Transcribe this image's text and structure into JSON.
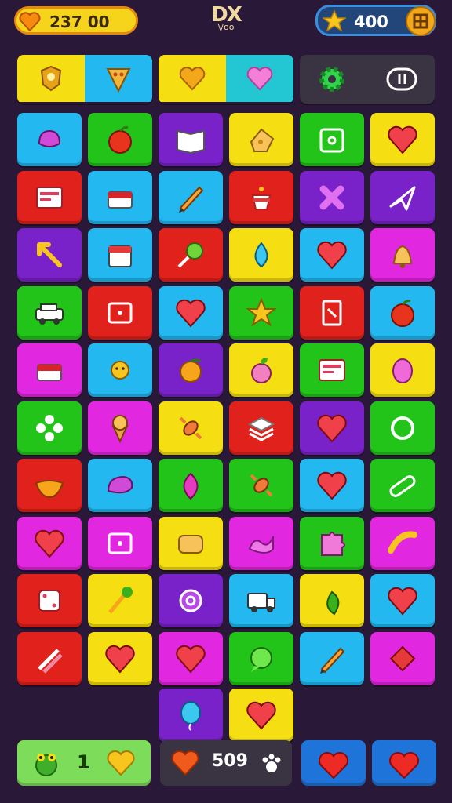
{
  "hud": {
    "coins": "237 00",
    "logo_text": "DX",
    "logo_sub": "\\/oo",
    "stars": "400"
  },
  "bottom": {
    "moves": "1",
    "lives": "509"
  },
  "colors": {
    "background": "#2a1838",
    "yellow": "#f5df12",
    "cyan": "#23b8ef",
    "purple": "#7a22c9",
    "green": "#22c41a",
    "red": "#e1211c",
    "magenta": "#e227e0",
    "dark": "#3a3342"
  },
  "tiles": [
    [
      "cyan",
      "blob-icon"
    ],
    [
      "green",
      "apple-icon"
    ],
    [
      "purple",
      "book-icon"
    ],
    [
      "yellow",
      "cheese-icon"
    ],
    [
      "green",
      "camera-icon"
    ],
    [
      "yellow",
      "heart-icon"
    ],
    [
      "red",
      "card-icon"
    ],
    [
      "cyan",
      "cake-icon"
    ],
    [
      "cyan",
      "pencil-icon"
    ],
    [
      "red",
      "cup-icon"
    ],
    [
      "purple",
      "cross-icon"
    ],
    [
      "purple",
      "plane-icon"
    ],
    [
      "purple",
      "arrow-icon"
    ],
    [
      "cyan",
      "box-icon"
    ],
    [
      "red",
      "lollipop-icon"
    ],
    [
      "yellow",
      "drop-icon"
    ],
    [
      "cyan",
      "heart-icon"
    ],
    [
      "magenta",
      "bell-icon"
    ],
    [
      "green",
      "car-icon"
    ],
    [
      "red",
      "frame-icon"
    ],
    [
      "cyan",
      "heart-icon"
    ],
    [
      "green",
      "star-icon"
    ],
    [
      "red",
      "door-icon"
    ],
    [
      "cyan",
      "apple-icon"
    ],
    [
      "magenta",
      "cake-icon"
    ],
    [
      "cyan",
      "sun-icon"
    ],
    [
      "purple",
      "orange-icon"
    ],
    [
      "yellow",
      "peach-icon"
    ],
    [
      "green",
      "card-icon"
    ],
    [
      "yellow",
      "egg-icon"
    ],
    [
      "green",
      "flower-icon"
    ],
    [
      "magenta",
      "icecream-icon"
    ],
    [
      "yellow",
      "candy-icon"
    ],
    [
      "red",
      "stack-icon"
    ],
    [
      "purple",
      "heart-icon"
    ],
    [
      "green",
      "ring-icon"
    ],
    [
      "red",
      "lips-icon"
    ],
    [
      "cyan",
      "shell-icon"
    ],
    [
      "green",
      "leaf-icon"
    ],
    [
      "green",
      "candy-icon"
    ],
    [
      "cyan",
      "heart-icon"
    ],
    [
      "green",
      "bandage-icon"
    ],
    [
      "magenta",
      "heart-icon"
    ],
    [
      "magenta",
      "frame-icon"
    ],
    [
      "yellow",
      "bread-icon"
    ],
    [
      "magenta",
      "wave-icon"
    ],
    [
      "green",
      "puzzle-icon"
    ],
    [
      "magenta",
      "banana-icon"
    ],
    [
      "red",
      "dice-icon"
    ],
    [
      "yellow",
      "brush-icon"
    ],
    [
      "purple",
      "target-icon"
    ],
    [
      "cyan",
      "truck-icon"
    ],
    [
      "yellow",
      "pepper-icon"
    ],
    [
      "cyan",
      "heart-icon"
    ],
    [
      "red",
      "pencils-icon"
    ],
    [
      "yellow",
      "heart-icon"
    ],
    [
      "magenta",
      "heart-icon"
    ],
    [
      "green",
      "bubble-icon"
    ],
    [
      "cyan",
      "pencil-icon"
    ],
    [
      "magenta",
      "diamond-icon"
    ]
  ],
  "extra_tiles": [
    [
      "purple",
      "balloon-icon"
    ],
    [
      "yellow",
      "heart-icon"
    ]
  ]
}
